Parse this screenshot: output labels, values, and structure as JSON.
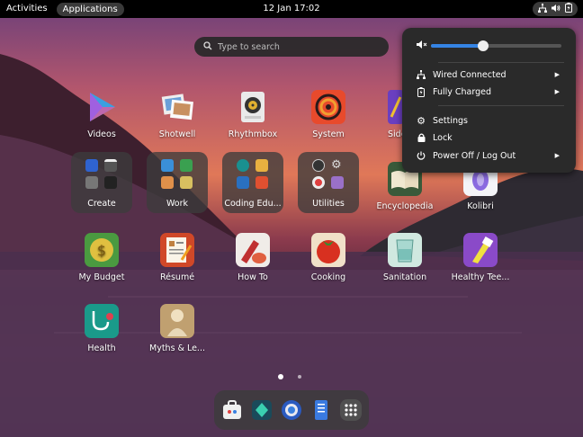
{
  "topbar": {
    "activities": "Activities",
    "applications": "Applications",
    "clock": "12 Jan  17:02"
  },
  "search": {
    "placeholder": "Type to search"
  },
  "apps": {
    "videos": "Videos",
    "shotwell": "Shotwell",
    "rhythmbox": "Rhythmbox",
    "system": "System",
    "sidebar_partial": "Side",
    "create": "Create",
    "work": "Work",
    "coding": "Coding Edu...",
    "utilities": "Utilities",
    "encyclopedia": "Encyclopedia",
    "kolibri": "Kolibri",
    "my_budget": "My Budget",
    "resume": "Résumé",
    "how_to": "How To",
    "cooking": "Cooking",
    "sanitation": "Sanitation",
    "healthy_teeth": "Healthy Tee...",
    "health": "Health",
    "myths": "Myths & Le..."
  },
  "menu": {
    "volume_level": 0.4,
    "wired": "Wired Connected",
    "battery": "Fully Charged",
    "settings": "Settings",
    "lock": "Lock",
    "power": "Power Off / Log Out"
  },
  "pages": {
    "count": 2,
    "current": 1
  },
  "colors": {
    "accent": "#3584e4",
    "topbar": "#000000",
    "menu_bg": "#2a2a2a"
  }
}
